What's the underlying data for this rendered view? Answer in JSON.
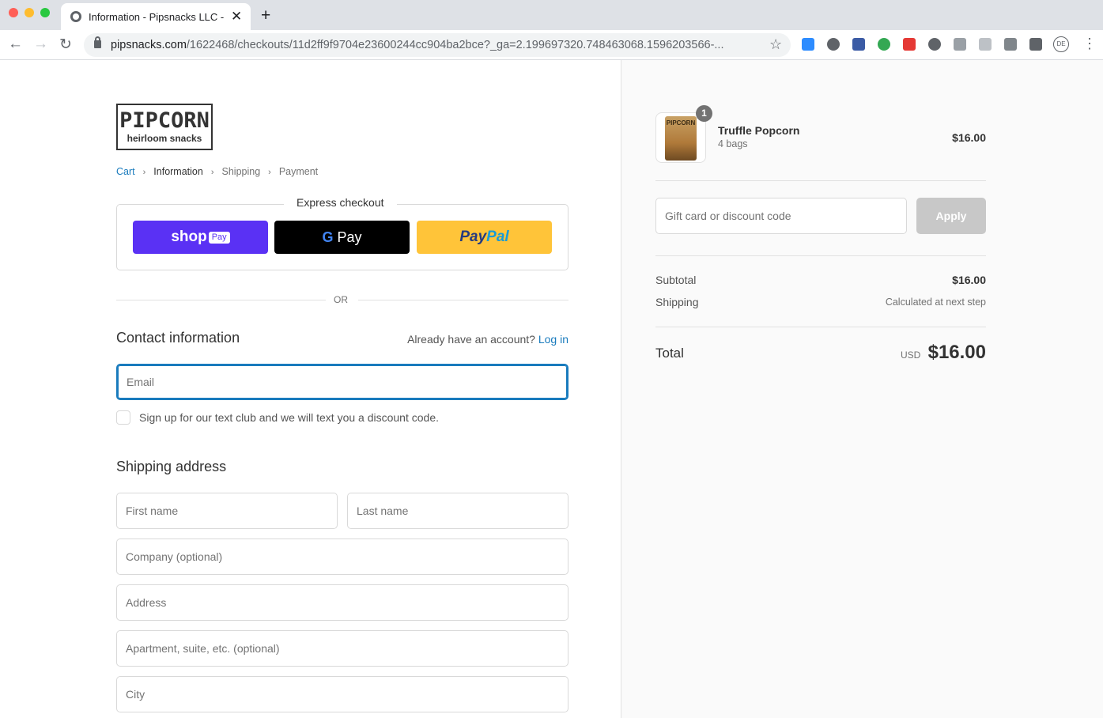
{
  "browser": {
    "tab_title": "Information - Pipsnacks LLC - C",
    "url_domain": "pipsnacks.com",
    "url_path": "/1622468/checkouts/11d2ff9f9704e23600244cc904ba2bce?_ga=2.199697320.748463068.1596203566-...",
    "profile_initials": "DE",
    "new_tab": "+",
    "close": "✕",
    "back": "←",
    "forward": "→",
    "reload": "↻",
    "star": "☆",
    "menu": "⋮"
  },
  "logo": {
    "line1": "PIPCORN",
    "line2": "heirloom snacks"
  },
  "breadcrumb": {
    "items": [
      "Cart",
      "Information",
      "Shipping",
      "Payment"
    ],
    "separator": "›"
  },
  "express": {
    "title": "Express checkout",
    "shop_label": "shop",
    "shop_badge": "Pay",
    "gpay_g": "G",
    "gpay_label": " Pay",
    "paypal_a": "Pay",
    "paypal_b": "Pal"
  },
  "or_text": "OR",
  "contact": {
    "heading": "Contact information",
    "account_prompt": "Already have an account?",
    "login": "Log in",
    "email_placeholder": "Email",
    "textclub": "Sign up for our text club and we will text you a discount code."
  },
  "shipping": {
    "heading": "Shipping address",
    "first_name": "First name",
    "last_name": "Last name",
    "company": "Company (optional)",
    "address": "Address",
    "apartment": "Apartment, suite, etc. (optional)",
    "city": "City"
  },
  "summary": {
    "product_name": "Truffle Popcorn",
    "product_variant": "4 bags",
    "product_price": "$16.00",
    "quantity": "1",
    "thumb_text": "PIPCORN",
    "discount_placeholder": "Gift card or discount code",
    "apply": "Apply",
    "subtotal_label": "Subtotal",
    "subtotal_value": "$16.00",
    "shipping_label": "Shipping",
    "shipping_value": "Calculated at next step",
    "total_label": "Total",
    "currency": "USD",
    "total_value": "$16.00"
  },
  "colors": {
    "accent": "#197bbd",
    "shop_pay": "#5a31f4",
    "paypal": "#ffc439"
  }
}
